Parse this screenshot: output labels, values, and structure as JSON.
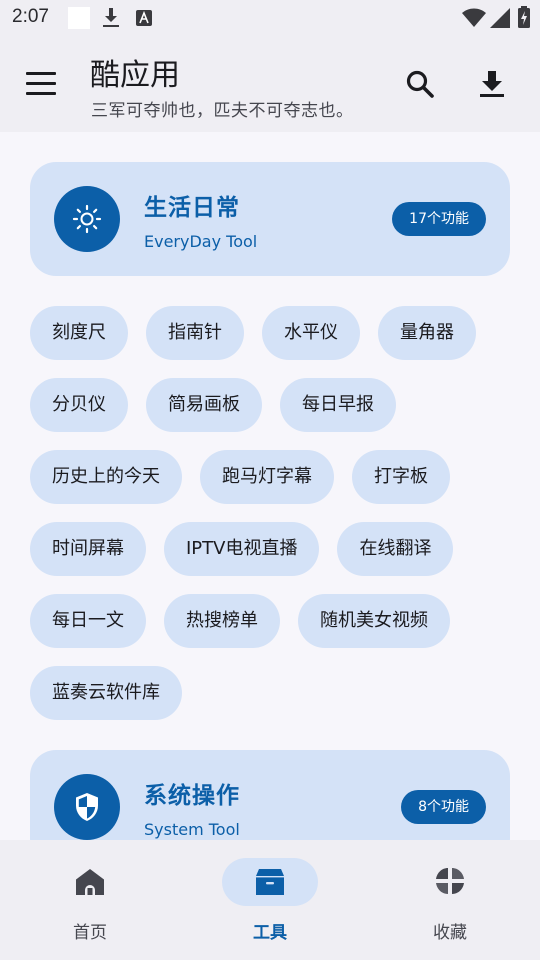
{
  "status": {
    "time": "2:07"
  },
  "app": {
    "title": "酷应用",
    "subtitle": "三军可夺帅也，匹夫不可夺志也。"
  },
  "icons": {
    "menu": "menu-icon",
    "search": "search-icon",
    "download": "download-icon",
    "everyday": "sun-icon",
    "system": "shield-icon"
  },
  "categories": [
    {
      "title": "生活日常",
      "subtitle": "EveryDay Tool",
      "badge": "17个功能",
      "chip_rows": [
        [
          "刻度尺",
          "指南针",
          "水平仪",
          "量角器"
        ],
        [
          "分贝仪",
          "简易画板",
          "每日早报"
        ],
        [
          "历史上的今天",
          "跑马灯字幕",
          "打字板"
        ],
        [
          "时间屏幕",
          "IPTV电视直播",
          "在线翻译"
        ],
        [
          "每日一文",
          "热搜榜单",
          "随机美女视频"
        ],
        [
          "蓝奏云软件库"
        ]
      ]
    },
    {
      "title": "系统操作",
      "subtitle": "System Tool",
      "badge": "8个功能"
    }
  ],
  "nav": {
    "items": [
      {
        "label": "首页",
        "icon": "home-icon"
      },
      {
        "label": "工具",
        "icon": "toolbox-icon",
        "active": true
      },
      {
        "label": "收藏",
        "icon": "favorites-icon"
      }
    ]
  },
  "colors": {
    "accent": "#0c5fa8",
    "card": "#d4e2f7",
    "background": "#f7f6fb"
  }
}
